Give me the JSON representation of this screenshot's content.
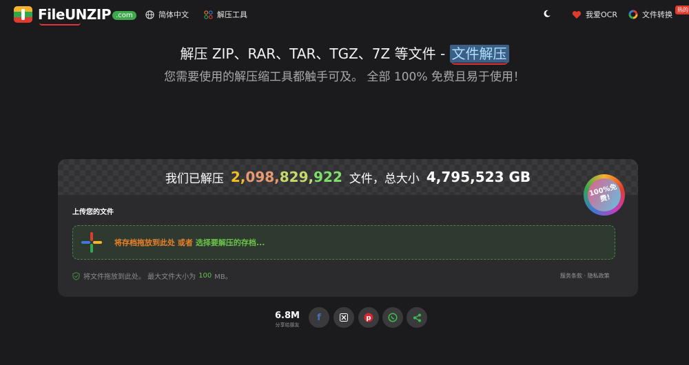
{
  "app": {
    "logo_text": "FileUNZIP",
    "logo_badge": ".com"
  },
  "nav": {
    "language": "简体中文",
    "tools": "解压工具",
    "ocr": "我爱OCR",
    "convert": "文件转换",
    "hot_badge": "热的"
  },
  "hero": {
    "title_prefix": "解压 ZIP、RAR、TAR、TGZ、7Z 等文件 - ",
    "title_highlight": "文件解压",
    "subtitle": "您需要使用的解压缩工具都触手可及。 全部 100% 免费且易于使用！"
  },
  "stats": {
    "prefix": "我们已解压",
    "count_parts": [
      "2,",
      "098,",
      "829,",
      "922"
    ],
    "middle": "文件，总大小",
    "total": "4,795,523 GB"
  },
  "badge": {
    "line1": "100%免",
    "line2": "费!"
  },
  "upload": {
    "label": "上传您的文件",
    "drop_text": "将存档拖放到此处 或者",
    "drop_link": "选择要解压的存档...",
    "hint_prefix": "将文件拖放到此处。 最大文件大小为",
    "max_size": "100",
    "hint_suffix": "MB。",
    "terms": "服务条款",
    "separator": " · ",
    "privacy": "隐私政策"
  },
  "share": {
    "count": "6.8M",
    "label": "分享给朋友",
    "buttons": [
      "facebook-icon",
      "x-icon",
      "pinterest-icon",
      "whatsapp-icon",
      "share-icon"
    ]
  },
  "colors": {
    "background": "#1b1b1d",
    "card": "#2b2b2d",
    "accent_orange": "#e8802a",
    "accent_green": "#6cc04a",
    "highlight_blue": "#3b5f86"
  }
}
